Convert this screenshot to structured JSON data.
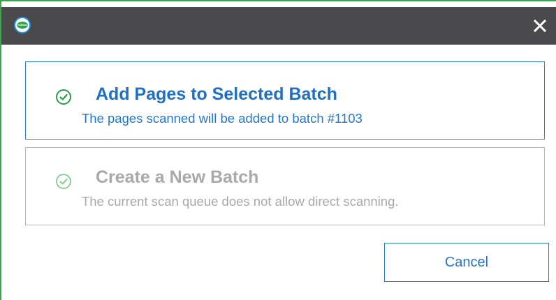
{
  "window": {
    "logo_text": "OnBase",
    "close_icon": "close-icon"
  },
  "options": [
    {
      "title": "Add Pages to Selected Batch",
      "description": "The pages scanned will be added to batch #1103",
      "enabled": true,
      "icon": "check-circle-icon",
      "icon_color": "#2e9a4a"
    },
    {
      "title": "Create a New Batch",
      "description": "The current scan queue does not allow direct scanning.",
      "enabled": false,
      "icon": "check-circle-icon",
      "icon_color": "#8fcf9c"
    }
  ],
  "buttons": {
    "cancel_label": "Cancel"
  },
  "colors": {
    "titlebar": "#4a4a4d",
    "accent_blue": "#2576c8",
    "disabled_text": "#a9a9a9",
    "window_border": "#3aa64a"
  }
}
